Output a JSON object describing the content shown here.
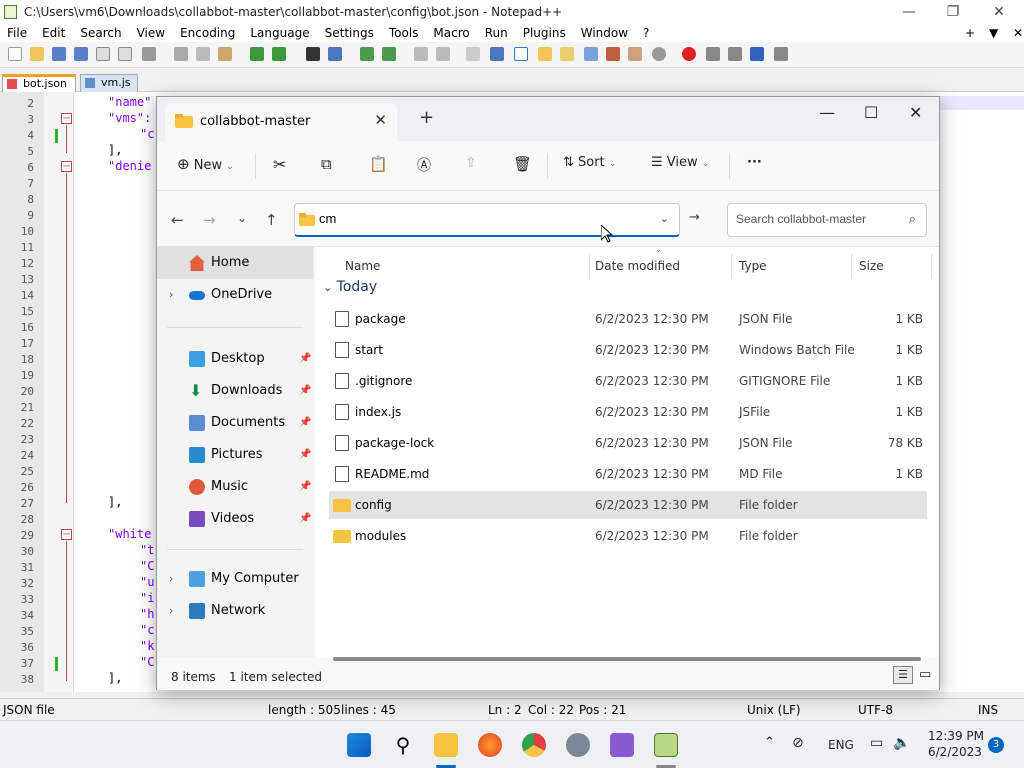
{
  "npp": {
    "title": "C:\\Users\\vm6\\Downloads\\collabbot-master\\collabbot-master\\config\\bot.json - Notepad++",
    "menu": [
      "File",
      "Edit",
      "Search",
      "View",
      "Encoding",
      "Language",
      "Settings",
      "Tools",
      "Macro",
      "Run",
      "Plugins",
      "Window",
      "?"
    ],
    "tabs": [
      {
        "label": "bot.json",
        "active": true
      },
      {
        "label": "vm.js",
        "active": false
      }
    ],
    "line_numbers": [
      "2",
      "3",
      "4",
      "5",
      "6",
      "7",
      "8",
      "9",
      "10",
      "11",
      "12",
      "13",
      "14",
      "15",
      "16",
      "17",
      "18",
      "19",
      "20",
      "21",
      "22",
      "23",
      "24",
      "25",
      "26",
      "27",
      "28",
      "29",
      "30",
      "31",
      "32",
      "33",
      "34",
      "35",
      "36",
      "37",
      "38"
    ],
    "code_lines": [
      {
        "line": "2",
        "text": "\"name\""
      },
      {
        "line": "3",
        "text": "\"vms\":"
      },
      {
        "line": "4",
        "text": "\"c"
      },
      {
        "line": "5",
        "text": "],"
      },
      {
        "line": "6",
        "text": "\"denie"
      },
      {
        "line": "27",
        "text": "],"
      },
      {
        "line": "29",
        "text": "\"white"
      },
      {
        "line": "30",
        "text": "\"t"
      },
      {
        "line": "31",
        "text": "\"C"
      },
      {
        "line": "32",
        "text": "\"u"
      },
      {
        "line": "33",
        "text": "\"i"
      },
      {
        "line": "34",
        "text": "\"h"
      },
      {
        "line": "35",
        "text": "\"c"
      },
      {
        "line": "36",
        "text": "\"k"
      },
      {
        "line": "37",
        "text": "\"C"
      },
      {
        "line": "38",
        "text": "],"
      }
    ],
    "status": {
      "file_type": "JSON file",
      "length": "length : 505",
      "lines": "lines : 45",
      "ln": "Ln : 2",
      "col": "Col : 22",
      "pos": "Pos : 21",
      "eol": "Unix (LF)",
      "encoding": "UTF-8",
      "mode": "INS"
    }
  },
  "explorer": {
    "tab_title": "collabbot-master",
    "commands": {
      "new": "New",
      "sort": "Sort",
      "view": "View",
      "more": "···"
    },
    "address_value": "cm",
    "search_placeholder": "Search collabbot-master",
    "nav": {
      "home": "Home",
      "onedrive": "OneDrive",
      "desktop": "Desktop",
      "downloads": "Downloads",
      "documents": "Documents",
      "pictures": "Pictures",
      "music": "Music",
      "videos": "Videos",
      "mycomputer": "My Computer",
      "network": "Network"
    },
    "columns": {
      "name": "Name",
      "date": "Date modified",
      "type": "Type",
      "size": "Size"
    },
    "group": "Today",
    "files": [
      {
        "name": "package",
        "date": "6/2/2023 12:30 PM",
        "type": "JSON File",
        "size": "1 KB",
        "kind": "file"
      },
      {
        "name": "start",
        "date": "6/2/2023 12:30 PM",
        "type": "Windows Batch File",
        "size": "1 KB",
        "kind": "file"
      },
      {
        "name": ".gitignore",
        "date": "6/2/2023 12:30 PM",
        "type": "GITIGNORE File",
        "size": "1 KB",
        "kind": "file"
      },
      {
        "name": "index.js",
        "date": "6/2/2023 12:30 PM",
        "type": "JSFile",
        "size": "1 KB",
        "kind": "file"
      },
      {
        "name": "package-lock",
        "date": "6/2/2023 12:30 PM",
        "type": "JSON File",
        "size": "78 KB",
        "kind": "file"
      },
      {
        "name": "README.md",
        "date": "6/2/2023 12:30 PM",
        "type": "MD File",
        "size": "1 KB",
        "kind": "file"
      },
      {
        "name": "config",
        "date": "6/2/2023 12:30 PM",
        "type": "File folder",
        "size": "",
        "kind": "folder",
        "selected": true
      },
      {
        "name": "modules",
        "date": "6/2/2023 12:30 PM",
        "type": "File folder",
        "size": "",
        "kind": "folder"
      }
    ],
    "status": {
      "items": "8 items",
      "selected": "1 item selected"
    }
  },
  "taskbar": {
    "language": "ENG",
    "time": "12:39 PM",
    "date": "6/2/2023",
    "notifications": "3"
  },
  "colors": {
    "accent": "#0067c0",
    "folder": "#f6c343",
    "selection": "#e3e3e3",
    "json_key": "#8000ff"
  }
}
